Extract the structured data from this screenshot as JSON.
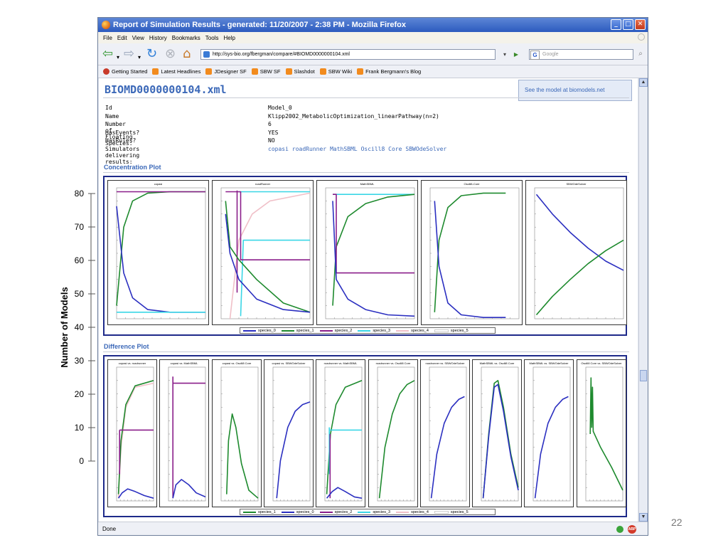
{
  "slide": {
    "y_axis_label": "Number of Models",
    "y_ticks": [
      "80",
      "70",
      "60",
      "50",
      "40",
      "30",
      "20",
      "10",
      "0"
    ],
    "page_number": "22"
  },
  "window": {
    "title": "Report of Simulation Results - generated: 11/20/2007 - 2:38 PM - Mozilla Firefox",
    "menu": [
      "File",
      "Edit",
      "View",
      "History",
      "Bookmarks",
      "Tools",
      "Help"
    ],
    "url": "http://sys-bio.org/fbergman/compare/#BIOMD0000000104.xml",
    "search_placeholder": "Google",
    "bookmarks": [
      "Getting Started",
      "Latest Headlines",
      "JDesigner SF",
      "SBW SF",
      "Slashdot",
      "SBW Wiki",
      "Frank Bergmann's Blog"
    ],
    "status": "Done"
  },
  "page": {
    "title": "BIOMD0000000104.xml",
    "biomodels_link": "See the model at biomodels.net",
    "info": [
      {
        "key": "Id",
        "value": "Model_0"
      },
      {
        "key": "Name",
        "value": "Klipp2002_MetabolicOptimization_linearPathway(n=2)"
      },
      {
        "key": "Number of Floating Species:",
        "value": "6"
      },
      {
        "key": "HasEvents?",
        "value": "YES"
      },
      {
        "key": "HasRules?",
        "value": "NO"
      },
      {
        "key": "Simulators delivering results:",
        "value": ""
      }
    ],
    "simulators": [
      "copasi",
      "roadRunner",
      "MathSBML",
      "Oscill8 Core",
      "SBWOdeSolver"
    ],
    "concentration_heading": "Concentration Plot",
    "difference_heading": "Difference Plot",
    "concentration_legend": [
      "species_0",
      "species_1",
      "species_2",
      "species_3",
      "species_4",
      "species_5"
    ],
    "difference_legend": [
      "species_1",
      "species_0",
      "species_2",
      "species_3",
      "species_4",
      "species_5"
    ]
  },
  "colors": {
    "species_0": "#2b2fc0",
    "species_1": "#1e8a2e",
    "species_2": "#8a1e8a",
    "species_3": "#3ad6e6",
    "species_4": "#f0c0c8",
    "species_5": "#ffffff",
    "frame": "#1e2a8a",
    "link": "#3b68b8"
  },
  "conc_panels": [
    {
      "title": "copasi",
      "curves": [
        {
          "s": "species_1",
          "pts": [
            [
              0,
              0.1
            ],
            [
              0.08,
              0.7
            ],
            [
              0.18,
              0.9
            ],
            [
              0.35,
              0.96
            ],
            [
              0.6,
              0.97
            ],
            [
              1,
              0.97
            ]
          ]
        },
        {
          "s": "species_0",
          "pts": [
            [
              0,
              0.86
            ],
            [
              0.08,
              0.35
            ],
            [
              0.18,
              0.16
            ],
            [
              0.35,
              0.07
            ],
            [
              0.6,
              0.05
            ],
            [
              1,
              0.05
            ]
          ]
        },
        {
          "s": "species_2",
          "pts": [
            [
              0,
              0.97
            ],
            [
              1,
              0.97
            ]
          ]
        },
        {
          "s": "species_3",
          "pts": [
            [
              0,
              0.05
            ],
            [
              1,
              0.05
            ]
          ]
        }
      ]
    },
    {
      "title": "roadRunner",
      "curves": [
        {
          "s": "species_4",
          "pts": [
            [
              0.1,
              0.0
            ],
            [
              0.2,
              0.6
            ],
            [
              0.35,
              0.8
            ],
            [
              0.55,
              0.9
            ],
            [
              1,
              0.96
            ]
          ]
        },
        {
          "s": "species_3",
          "pts": [
            [
              0.2,
              0.97
            ],
            [
              1,
              0.97
            ]
          ]
        },
        {
          "s": "species_3",
          "pts": [
            [
              0.22,
              0.02
            ],
            [
              0.25,
              0.6
            ],
            [
              1,
              0.6
            ]
          ]
        },
        {
          "s": "species_2",
          "pts": [
            [
              0.05,
              0.97
            ],
            [
              0.22,
              0.97
            ],
            [
              0.22,
              0.45
            ],
            [
              1,
              0.45
            ]
          ]
        },
        {
          "s": "species_2",
          "pts": [
            [
              0.18,
              0.98
            ],
            [
              0.18,
              0.2
            ]
          ]
        },
        {
          "s": "species_1",
          "pts": [
            [
              0.05,
              0.9
            ],
            [
              0.1,
              0.55
            ],
            [
              0.2,
              0.45
            ],
            [
              0.4,
              0.3
            ],
            [
              0.7,
              0.12
            ],
            [
              1,
              0.05
            ]
          ]
        },
        {
          "s": "species_0",
          "pts": [
            [
              0.05,
              0.8
            ],
            [
              0.1,
              0.5
            ],
            [
              0.2,
              0.3
            ],
            [
              0.4,
              0.15
            ],
            [
              0.7,
              0.07
            ],
            [
              1,
              0.05
            ]
          ]
        }
      ]
    },
    {
      "title": "MathSBML",
      "curves": [
        {
          "s": "species_3",
          "pts": [
            [
              0.08,
              0.95
            ],
            [
              1,
              0.95
            ]
          ]
        },
        {
          "s": "species_1",
          "pts": [
            [
              0.08,
              0.1
            ],
            [
              0.12,
              0.55
            ],
            [
              0.25,
              0.78
            ],
            [
              0.45,
              0.88
            ],
            [
              0.7,
              0.93
            ],
            [
              1,
              0.95
            ]
          ]
        },
        {
          "s": "species_2",
          "pts": [
            [
              0.08,
              0.95
            ],
            [
              0.12,
              0.95
            ],
            [
              0.12,
              0.35
            ],
            [
              1,
              0.35
            ]
          ]
        },
        {
          "s": "species_0",
          "pts": [
            [
              0.08,
              0.9
            ],
            [
              0.12,
              0.3
            ],
            [
              0.25,
              0.15
            ],
            [
              0.45,
              0.07
            ],
            [
              0.7,
              0.03
            ],
            [
              1,
              0.02
            ]
          ]
        }
      ]
    },
    {
      "title": "Oscill8-Core",
      "curves": [
        {
          "s": "species_1",
          "pts": [
            [
              0.05,
              0.05
            ],
            [
              0.1,
              0.6
            ],
            [
              0.2,
              0.85
            ],
            [
              0.35,
              0.94
            ],
            [
              0.6,
              0.96
            ],
            [
              0.85,
              0.96
            ]
          ]
        },
        {
          "s": "species_0",
          "pts": [
            [
              0.05,
              0.9
            ],
            [
              0.1,
              0.4
            ],
            [
              0.2,
              0.12
            ],
            [
              0.35,
              0.03
            ],
            [
              0.6,
              0.01
            ],
            [
              0.85,
              0.01
            ]
          ]
        }
      ]
    },
    {
      "title": "SBWOdeSolver",
      "curves": [
        {
          "s": "species_0",
          "pts": [
            [
              0.02,
              0.95
            ],
            [
              0.2,
              0.8
            ],
            [
              0.4,
              0.66
            ],
            [
              0.6,
              0.54
            ],
            [
              0.8,
              0.44
            ],
            [
              1,
              0.37
            ]
          ]
        },
        {
          "s": "species_1",
          "pts": [
            [
              0.02,
              0.03
            ],
            [
              0.2,
              0.17
            ],
            [
              0.4,
              0.3
            ],
            [
              0.6,
              0.42
            ],
            [
              0.8,
              0.52
            ],
            [
              1,
              0.6
            ]
          ]
        }
      ]
    }
  ],
  "diff_panels": [
    {
      "title": "copasi vs. roadrunner",
      "curves": [
        {
          "s": "species_4",
          "pts": [
            [
              0.05,
              0.02
            ],
            [
              0.12,
              0.4
            ],
            [
              0.25,
              0.7
            ],
            [
              0.5,
              0.85
            ],
            [
              1,
              0.88
            ]
          ]
        },
        {
          "s": "species_1",
          "pts": [
            [
              0.05,
              0.05
            ],
            [
              0.12,
              0.45
            ],
            [
              0.25,
              0.72
            ],
            [
              0.5,
              0.86
            ],
            [
              1,
              0.9
            ]
          ]
        },
        {
          "s": "species_2",
          "pts": [
            [
              0.08,
              0.2
            ],
            [
              0.08,
              0.53
            ]
          ]
        },
        {
          "s": "species_2",
          "pts": [
            [
              0.08,
              0.53
            ],
            [
              1,
              0.53
            ]
          ]
        },
        {
          "s": "species_0",
          "pts": [
            [
              0.05,
              0.02
            ],
            [
              0.15,
              0.06
            ],
            [
              0.3,
              0.09
            ],
            [
              0.5,
              0.07
            ],
            [
              0.75,
              0.04
            ],
            [
              1,
              0.02
            ]
          ]
        }
      ]
    },
    {
      "title": "copasi vs. MathSBML",
      "curves": [
        {
          "s": "species_2",
          "pts": [
            [
              0.12,
              0.02
            ],
            [
              0.12,
              0.93
            ]
          ]
        },
        {
          "s": "species_2",
          "pts": [
            [
              0.12,
              0.88
            ],
            [
              1,
              0.88
            ]
          ]
        },
        {
          "s": "species_0",
          "pts": [
            [
              0.12,
              0.02
            ],
            [
              0.2,
              0.12
            ],
            [
              0.35,
              0.16
            ],
            [
              0.55,
              0.12
            ],
            [
              0.75,
              0.06
            ],
            [
              1,
              0.03
            ]
          ]
        }
      ]
    },
    {
      "title": "copasi vs. Oscill8 Core",
      "curves": [
        {
          "s": "species_1",
          "pts": [
            [
              0.15,
              0.05
            ],
            [
              0.2,
              0.45
            ],
            [
              0.3,
              0.65
            ],
            [
              0.4,
              0.55
            ],
            [
              0.55,
              0.28
            ],
            [
              0.75,
              0.08
            ],
            [
              1,
              0.02
            ]
          ]
        }
      ]
    },
    {
      "title": "copasi vs. SBWOdeSolver",
      "curves": [
        {
          "s": "species_0",
          "pts": [
            [
              0.1,
              0.02
            ],
            [
              0.2,
              0.3
            ],
            [
              0.4,
              0.55
            ],
            [
              0.6,
              0.67
            ],
            [
              0.8,
              0.72
            ],
            [
              1,
              0.74
            ]
          ]
        }
      ]
    },
    {
      "title": "roadrunner vs. MathSBML",
      "curves": [
        {
          "s": "species_1",
          "pts": [
            [
              0.05,
              0.05
            ],
            [
              0.15,
              0.5
            ],
            [
              0.3,
              0.72
            ],
            [
              0.55,
              0.85
            ],
            [
              1,
              0.9
            ]
          ]
        },
        {
          "s": "species_3",
          "pts": [
            [
              0.12,
              0.2
            ],
            [
              0.12,
              0.55
            ]
          ]
        },
        {
          "s": "species_3",
          "pts": [
            [
              0.12,
              0.53
            ],
            [
              1,
              0.53
            ]
          ]
        },
        {
          "s": "species_2",
          "pts": [
            [
              0.14,
              0.02
            ],
            [
              0.14,
              0.5
            ]
          ]
        },
        {
          "s": "species_0",
          "pts": [
            [
              0.05,
              0.02
            ],
            [
              0.2,
              0.07
            ],
            [
              0.35,
              0.1
            ],
            [
              0.55,
              0.07
            ],
            [
              0.8,
              0.03
            ],
            [
              1,
              0.02
            ]
          ]
        }
      ]
    },
    {
      "title": "roadrunner vs. Oscill8 Core",
      "curves": [
        {
          "s": "species_1",
          "pts": [
            [
              0.05,
              0.02
            ],
            [
              0.2,
              0.4
            ],
            [
              0.4,
              0.65
            ],
            [
              0.6,
              0.8
            ],
            [
              0.8,
              0.87
            ],
            [
              1,
              0.9
            ]
          ]
        }
      ]
    },
    {
      "title": "roadrunner vs. SBWOdeSolver",
      "curves": [
        {
          "s": "species_0",
          "pts": [
            [
              0.05,
              0.02
            ],
            [
              0.2,
              0.35
            ],
            [
              0.4,
              0.58
            ],
            [
              0.6,
              0.7
            ],
            [
              0.8,
              0.76
            ],
            [
              0.95,
              0.78
            ]
          ]
        }
      ]
    },
    {
      "title": "MathSBML vs. Oscill8 Core",
      "curves": [
        {
          "s": "species_1",
          "pts": [
            [
              0.05,
              0.02
            ],
            [
              0.2,
              0.5
            ],
            [
              0.35,
              0.88
            ],
            [
              0.45,
              0.9
            ],
            [
              0.6,
              0.7
            ],
            [
              0.8,
              0.35
            ],
            [
              1,
              0.1
            ]
          ]
        },
        {
          "s": "species_0",
          "pts": [
            [
              0.05,
              0.02
            ],
            [
              0.2,
              0.48
            ],
            [
              0.35,
              0.85
            ],
            [
              0.45,
              0.87
            ],
            [
              0.6,
              0.67
            ],
            [
              0.8,
              0.33
            ],
            [
              1,
              0.08
            ]
          ]
        }
      ]
    },
    {
      "title": "MathSBML vs. SBWOdeSolver",
      "curves": [
        {
          "s": "species_0",
          "pts": [
            [
              0.05,
              0.02
            ],
            [
              0.2,
              0.35
            ],
            [
              0.4,
              0.58
            ],
            [
              0.6,
              0.7
            ],
            [
              0.8,
              0.76
            ],
            [
              0.95,
              0.78
            ]
          ]
        }
      ]
    },
    {
      "title": "Oscill8 Core vs. SBWOdeSolver",
      "curves": [
        {
          "s": "species_1",
          "pts": [
            [
              0.12,
              0.5
            ],
            [
              0.14,
              0.92
            ],
            [
              0.16,
              0.55
            ],
            [
              0.18,
              0.85
            ],
            [
              0.2,
              0.52
            ],
            [
              0.4,
              0.4
            ],
            [
              0.7,
              0.25
            ],
            [
              1,
              0.08
            ]
          ]
        }
      ]
    }
  ]
}
